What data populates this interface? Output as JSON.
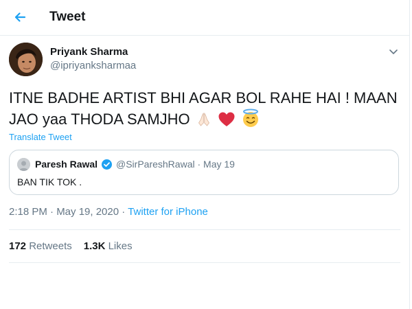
{
  "header": {
    "title": "Tweet",
    "back_icon": "arrow-left-icon",
    "accent": "#1da1f2"
  },
  "author": {
    "name": "Priyank Sharma",
    "handle": "@ipriyanksharmaa"
  },
  "tweet": {
    "text": "ITNE BADHE ARTIST BHI AGAR BOL RAHE HAI ! MAAN JAO yaa THODA SAMJHO",
    "emojis": [
      "folded-hands-icon",
      "red-heart-icon",
      "smiling-face-with-halo-icon"
    ],
    "translate_label": "Translate Tweet"
  },
  "quote": {
    "name": "Paresh Rawal",
    "handle": "@SirPareshRawal",
    "date": "May 19",
    "handle_date": "@SirPareshRawal · May 19",
    "text": "BAN TIK TOK ."
  },
  "meta": {
    "time": "2:18 PM",
    "date": "May 19, 2020",
    "time_date": "2:18 PM · May 19, 2020 · ",
    "source": "Twitter for iPhone"
  },
  "stats": {
    "retweets_count": "172",
    "retweets_label": "Retweets",
    "likes_count": "1.3K",
    "likes_label": "Likes"
  }
}
